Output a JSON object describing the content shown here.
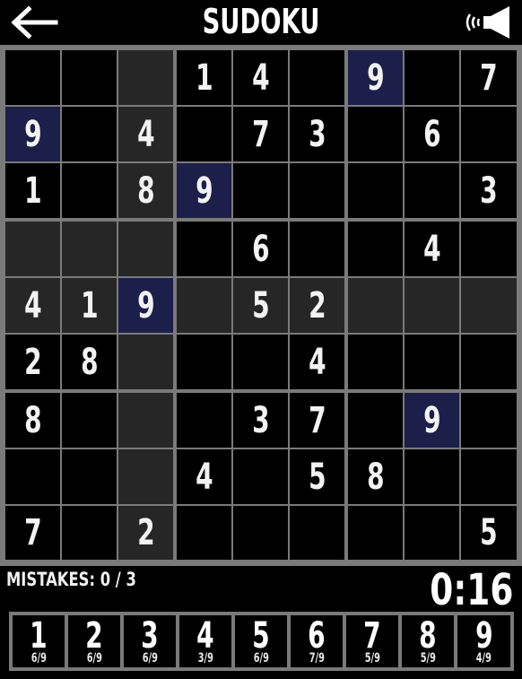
{
  "header": {
    "title": "SUDOKU",
    "back_icon": "arrow-left-icon",
    "sound_icon": "speaker-icon"
  },
  "colors": {
    "cell_empty": "#000000",
    "cell_shaded": "#262626",
    "cell_highlight": "#1c1f4a",
    "grid_line": "#7a7a7a",
    "text": "#f2f2f2"
  },
  "board": {
    "grid": [
      [
        "",
        "",
        "",
        "1",
        "4",
        "",
        "9",
        "",
        "7"
      ],
      [
        "9",
        "",
        "4",
        "",
        "7",
        "3",
        "",
        "6",
        ""
      ],
      [
        "1",
        "",
        "8",
        "9",
        "",
        "",
        "",
        "",
        "3"
      ],
      [
        "",
        "",
        "",
        "",
        "6",
        "",
        "",
        "4",
        ""
      ],
      [
        "4",
        "1",
        "9",
        "",
        "5",
        "2",
        "",
        "",
        ""
      ],
      [
        "2",
        "8",
        "",
        "",
        "",
        "4",
        "",
        "",
        ""
      ],
      [
        "8",
        "",
        "",
        "",
        "3",
        "7",
        "",
        "9",
        ""
      ],
      [
        "",
        "",
        "",
        "4",
        "",
        "5",
        "8",
        "",
        ""
      ],
      [
        "7",
        "",
        "2",
        "",
        "",
        "",
        "",
        "",
        "5"
      ]
    ],
    "shade": [
      [
        "e",
        "e",
        "s",
        "e",
        "e",
        "e",
        "h",
        "e",
        "e"
      ],
      [
        "h",
        "e",
        "s",
        "e",
        "e",
        "e",
        "e",
        "e",
        "e"
      ],
      [
        "e",
        "e",
        "s",
        "h",
        "e",
        "e",
        "e",
        "e",
        "e"
      ],
      [
        "s",
        "s",
        "s",
        "e",
        "e",
        "e",
        "e",
        "e",
        "e"
      ],
      [
        "s",
        "s",
        "h",
        "s",
        "s",
        "s",
        "s",
        "s",
        "s"
      ],
      [
        "e",
        "e",
        "s",
        "e",
        "e",
        "e",
        "e",
        "e",
        "e"
      ],
      [
        "e",
        "e",
        "s",
        "e",
        "e",
        "e",
        "e",
        "h",
        "e"
      ],
      [
        "e",
        "e",
        "s",
        "e",
        "e",
        "e",
        "e",
        "e",
        "e"
      ],
      [
        "e",
        "e",
        "s",
        "e",
        "e",
        "e",
        "e",
        "e",
        "e"
      ]
    ]
  },
  "status": {
    "mistakes": "MISTAKES: 0 / 3",
    "timer": "0:16"
  },
  "numpad": [
    {
      "digit": "1",
      "count": "6/9"
    },
    {
      "digit": "2",
      "count": "6/9"
    },
    {
      "digit": "3",
      "count": "6/9"
    },
    {
      "digit": "4",
      "count": "3/9"
    },
    {
      "digit": "5",
      "count": "6/9"
    },
    {
      "digit": "6",
      "count": "7/9"
    },
    {
      "digit": "7",
      "count": "5/9"
    },
    {
      "digit": "8",
      "count": "5/9"
    },
    {
      "digit": "9",
      "count": "4/9"
    }
  ]
}
